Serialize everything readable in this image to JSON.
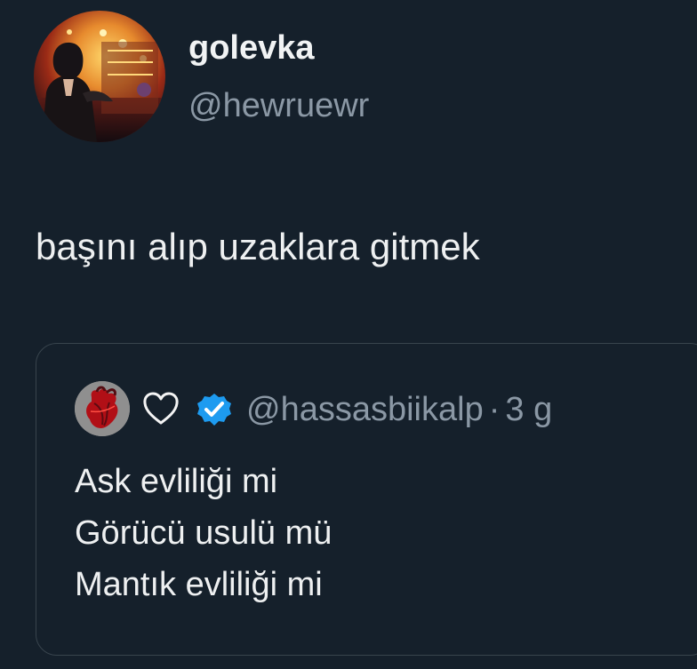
{
  "tweet": {
    "author": {
      "display_name": "golevka",
      "handle": "@hewruewr",
      "avatar_icon": "profile-photo-icon"
    },
    "text": "başını alıp uzaklara gitmek"
  },
  "quoted_tweet": {
    "handle": "@hassasbiikalp",
    "separator": "·",
    "time": "3 g",
    "name_icons": [
      "heart-icon",
      "verified-badge-icon"
    ],
    "lines": [
      "Ask evliliği mi",
      "Görücü usulü mü",
      "Mantık evliliği mi"
    ]
  },
  "colors": {
    "background": "#15202b",
    "text": "#eef0f1",
    "secondary_text": "#8b98a5",
    "border": "#38444d",
    "verified": "#1d9bf0"
  }
}
